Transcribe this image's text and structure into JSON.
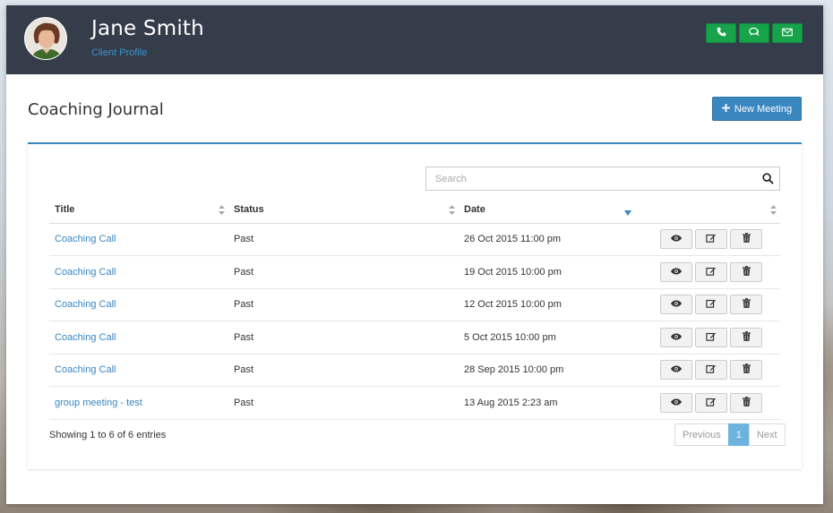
{
  "header": {
    "client_name": "Jane Smith",
    "client_subtitle": "Client Profile",
    "actions": [
      {
        "icon": "phone-icon"
      },
      {
        "icon": "chat-icon"
      },
      {
        "icon": "envelope-icon"
      }
    ]
  },
  "journal": {
    "title": "Coaching Journal",
    "new_meeting_label": "New Meeting"
  },
  "search": {
    "placeholder": "Search",
    "value": ""
  },
  "table": {
    "columns": [
      "Title",
      "Status",
      "Date",
      ""
    ],
    "rows": [
      {
        "title": "Coaching Call",
        "status": "Past",
        "date": "26 Oct 2015 11:00 pm"
      },
      {
        "title": "Coaching Call",
        "status": "Past",
        "date": "19 Oct 2015 10:00 pm"
      },
      {
        "title": "Coaching Call",
        "status": "Past",
        "date": "12 Oct 2015 10:00 pm"
      },
      {
        "title": "Coaching Call",
        "status": "Past",
        "date": "5 Oct 2015 10:00 pm"
      },
      {
        "title": "Coaching Call",
        "status": "Past",
        "date": "28 Sep 2015 10:00 pm"
      },
      {
        "title": "group meeting - test",
        "status": "Past",
        "date": "13 Aug 2015 2:23 am"
      }
    ],
    "row_actions": [
      "eye-icon",
      "edit-icon",
      "trash-icon"
    ]
  },
  "footer": {
    "info": "Showing 1 to 6 of 6 entries",
    "prev_label": "Previous",
    "page": "1",
    "next_label": "Next"
  },
  "colors": {
    "header_bg": "#353c4a",
    "accent": "#3a87c0",
    "success": "#16a34a"
  }
}
